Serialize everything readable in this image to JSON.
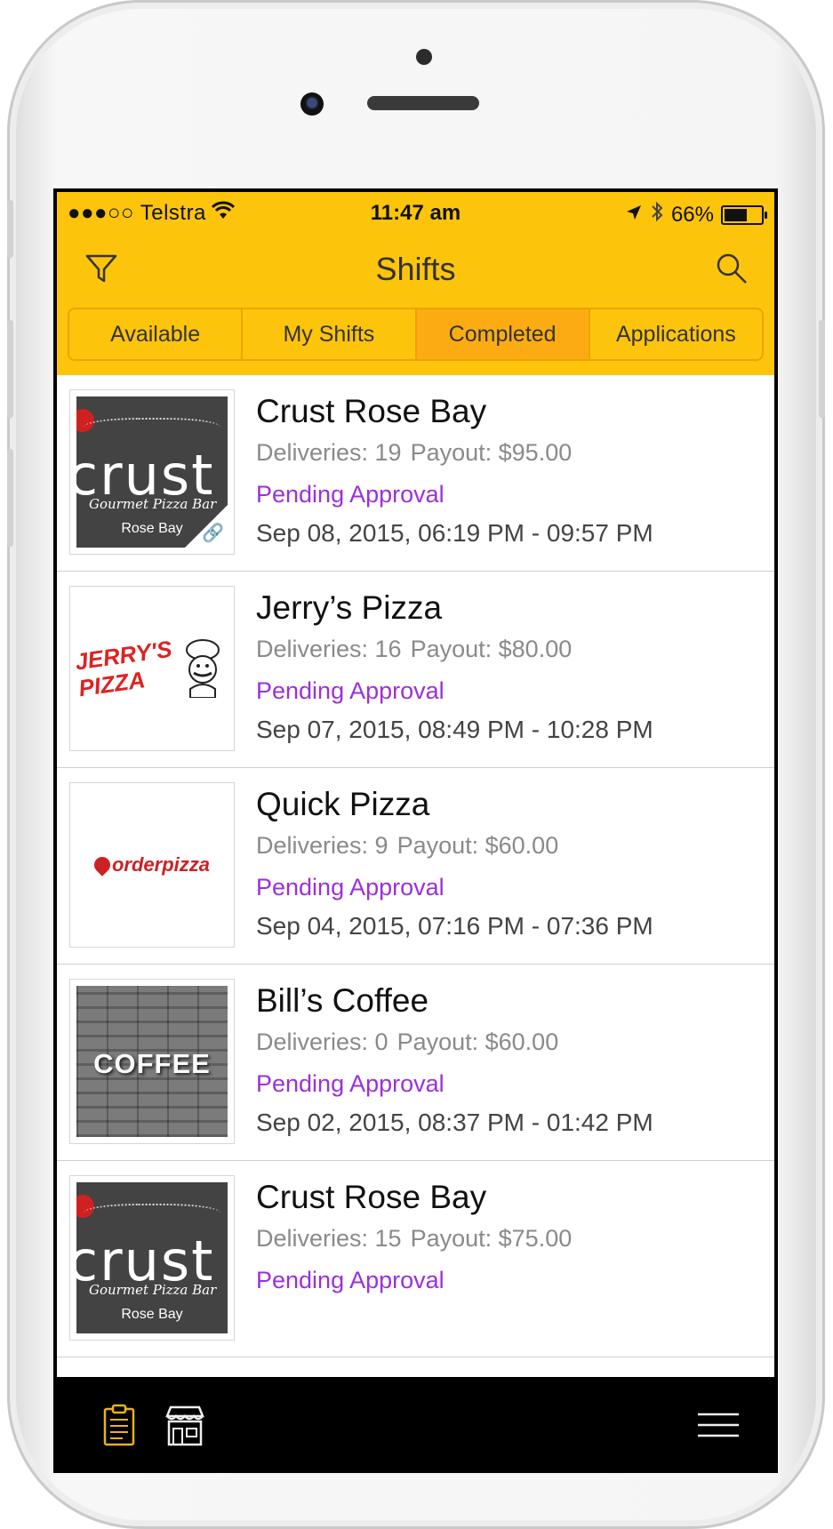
{
  "status_bar": {
    "carrier": "●●●○○ Telstra",
    "time": "11:47 am",
    "battery": "66%",
    "battery_level": 0.66
  },
  "nav": {
    "title": "Shifts"
  },
  "segments": [
    {
      "label": "Available",
      "active": false
    },
    {
      "label": "My Shifts",
      "active": false
    },
    {
      "label": "Completed",
      "active": true
    },
    {
      "label": "Applications",
      "active": false
    }
  ],
  "shifts": [
    {
      "name": "Crust Rose Bay",
      "deliveries": "Deliveries: 19",
      "payout": "Payout: $95.00",
      "status": "Pending Approval",
      "dates": "Sep 08, 2015, 06:19 PM - 09:57 PM",
      "logo": {
        "type": "crust",
        "word": "crust",
        "sub": "Gourmet Pizza Bar",
        "loc": "Rose Bay"
      }
    },
    {
      "name": "Jerry’s Pizza",
      "deliveries": "Deliveries: 16",
      "payout": "Payout: $80.00",
      "status": "Pending Approval",
      "dates": "Sep 07, 2015, 08:49 PM - 10:28 PM",
      "logo": {
        "type": "jerry",
        "line1": "JERRY'S",
        "line2": "PIZZA"
      }
    },
    {
      "name": "Quick Pizza",
      "deliveries": "Deliveries: 9",
      "payout": "Payout: $60.00",
      "status": "Pending Approval",
      "dates": "Sep 04, 2015, 07:16 PM - 07:36 PM",
      "logo": {
        "type": "order",
        "word": "orderpizza"
      }
    },
    {
      "name": "Bill’s Coffee",
      "deliveries": "Deliveries: 0",
      "payout": "Payout: $60.00",
      "status": "Pending Approval",
      "dates": "Sep 02, 2015, 08:37 PM - 01:42 PM",
      "logo": {
        "type": "coffee",
        "word": "COFFEE"
      }
    },
    {
      "name": "Crust Rose Bay",
      "deliveries": "Deliveries: 15",
      "payout": "Payout: $75.00",
      "status": "Pending Approval",
      "dates": "",
      "logo": {
        "type": "crust",
        "word": "crust",
        "sub": "Gourmet Pizza Bar",
        "loc": "Rose Bay"
      }
    }
  ],
  "tabbar": {
    "icons": [
      "clipboard-icon",
      "store-icon",
      "menu-icon"
    ],
    "active_color": "#e8b21a"
  },
  "colors": {
    "header": "#fdc40c",
    "segment_active": "#fcac12",
    "status_pending": "#9b30d9"
  }
}
